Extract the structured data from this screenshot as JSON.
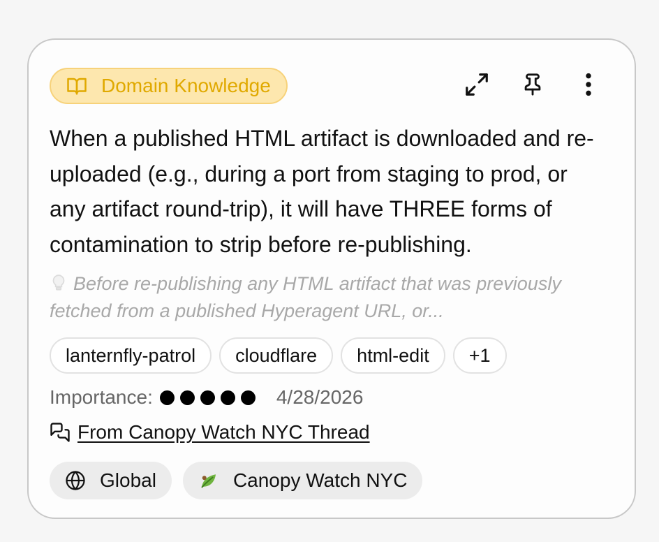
{
  "card": {
    "category": {
      "label": "Domain Knowledge",
      "icon": "book-open-icon",
      "color": "#e0a900",
      "background": "#fde7ae"
    },
    "actions": [
      {
        "name": "expand",
        "icon": "expand-icon"
      },
      {
        "name": "pin",
        "icon": "pin-icon"
      },
      {
        "name": "more",
        "icon": "more-vertical-icon"
      }
    ],
    "body": "When a published HTML artifact is downloaded and re-uploaded (e.g., during a port from staging to prod, or any artifact round-trip), it will have THREE forms of contamination to strip before re-publishing.",
    "tip": {
      "icon": "lightbulb-icon",
      "text": "Before re-publishing any HTML artifact that was previously fetched from a published Hyperagent URL, or..."
    },
    "tags": [
      "lanternfly-patrol",
      "cloudflare",
      "html-edit",
      "+1"
    ],
    "importance": {
      "label": "Importance:",
      "level": 5,
      "max": 5
    },
    "date": "4/28/2026",
    "source": {
      "icon": "chat-bubbles-icon",
      "label": "From Canopy Watch NYC Thread"
    },
    "scopes": [
      {
        "label": "Global",
        "icon": "globe-icon"
      },
      {
        "label": "Canopy Watch NYC",
        "icon": "leaf-icon"
      }
    ]
  }
}
